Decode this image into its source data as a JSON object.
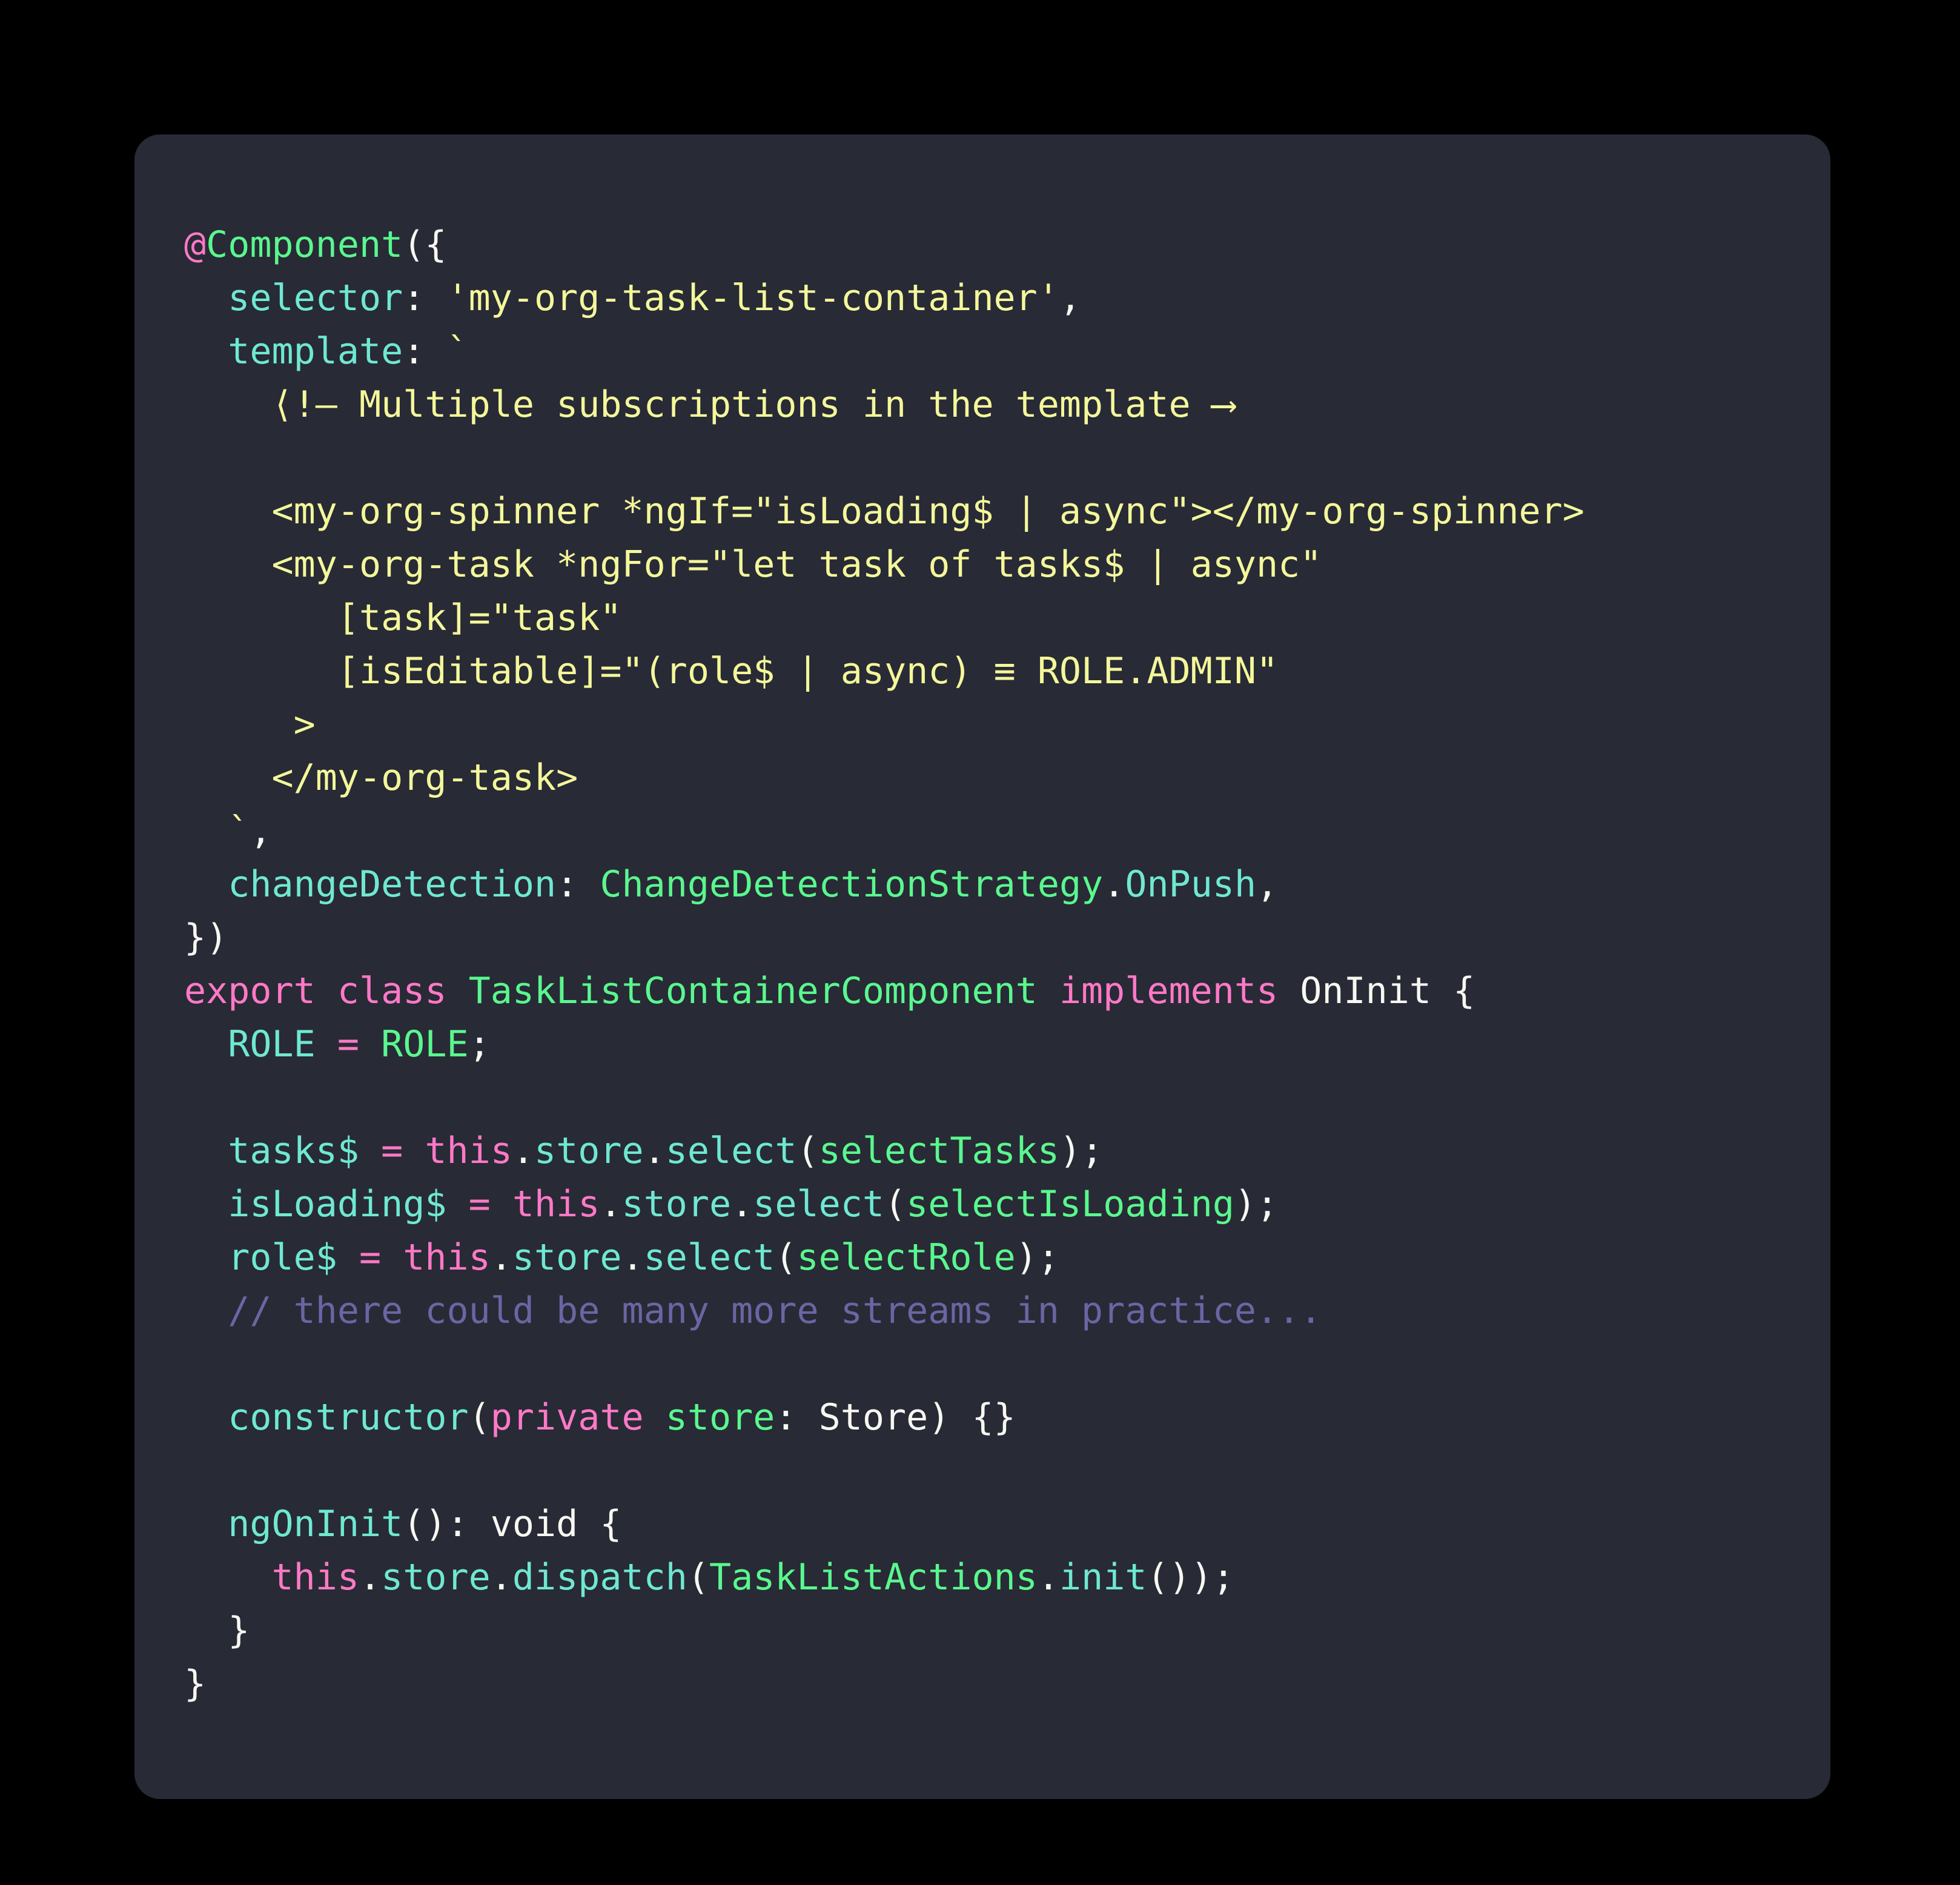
{
  "theme": {
    "page_background": "#000000",
    "card_background": "#282a36",
    "foreground": "#f8f8f2",
    "keyword_pink": "#ff79c6",
    "class_green": "#5af78e",
    "function_cyan": "#6fe8d2",
    "string_yellow": "#f4f79a",
    "comment_purple": "#6a66a3"
  },
  "code": {
    "language": "typescript",
    "title": "TaskListContainerComponent",
    "lines": [
      {
        "n": 1,
        "tokens": [
          {
            "t": "@",
            "c": "pink"
          },
          {
            "t": "Component",
            "c": "green"
          },
          {
            "t": "({",
            "c": "plain"
          }
        ]
      },
      {
        "n": 2,
        "tokens": [
          {
            "t": "  ",
            "c": "plain"
          },
          {
            "t": "selector",
            "c": "cyan"
          },
          {
            "t": ": ",
            "c": "plain"
          },
          {
            "t": "'my-org-task-list-container'",
            "c": "yellow"
          },
          {
            "t": ",",
            "c": "plain"
          }
        ]
      },
      {
        "n": 3,
        "tokens": [
          {
            "t": "  ",
            "c": "plain"
          },
          {
            "t": "template",
            "c": "cyan"
          },
          {
            "t": ": ",
            "c": "plain"
          },
          {
            "t": "`",
            "c": "yellow"
          }
        ]
      },
      {
        "n": 4,
        "tokens": [
          {
            "t": "    ",
            "c": "plain"
          },
          {
            "t": "<!-- Multiple subscriptions in the template -->",
            "c": "yellow"
          }
        ]
      },
      {
        "n": 5,
        "tokens": []
      },
      {
        "n": 6,
        "tokens": [
          {
            "t": "    ",
            "c": "plain"
          },
          {
            "t": "<my-org-spinner *ngIf=\"isLoading$ | async\"></my-org-spinner>",
            "c": "yellow"
          }
        ]
      },
      {
        "n": 7,
        "tokens": [
          {
            "t": "    ",
            "c": "plain"
          },
          {
            "t": "<my-org-task *ngFor=\"let task of tasks$ | async\"",
            "c": "yellow"
          }
        ]
      },
      {
        "n": 8,
        "tokens": [
          {
            "t": "       ",
            "c": "plain"
          },
          {
            "t": "[task]=\"task\"",
            "c": "yellow"
          }
        ]
      },
      {
        "n": 9,
        "tokens": [
          {
            "t": "       ",
            "c": "plain"
          },
          {
            "t": "[isEditable]=\"(role$ | async) === ROLE.ADMIN\"",
            "c": "yellow"
          }
        ]
      },
      {
        "n": 10,
        "tokens": [
          {
            "t": "     ",
            "c": "plain"
          },
          {
            "t": ">",
            "c": "yellow"
          }
        ]
      },
      {
        "n": 11,
        "tokens": [
          {
            "t": "    ",
            "c": "plain"
          },
          {
            "t": "</my-org-task>",
            "c": "yellow"
          }
        ]
      },
      {
        "n": 12,
        "tokens": [
          {
            "t": "  ",
            "c": "plain"
          },
          {
            "t": "`",
            "c": "yellow"
          },
          {
            "t": ",",
            "c": "plain"
          }
        ]
      },
      {
        "n": 13,
        "tokens": [
          {
            "t": "  ",
            "c": "plain"
          },
          {
            "t": "changeDetection",
            "c": "cyan"
          },
          {
            "t": ": ",
            "c": "plain"
          },
          {
            "t": "ChangeDetectionStrategy",
            "c": "green"
          },
          {
            "t": ".",
            "c": "plain"
          },
          {
            "t": "OnPush",
            "c": "cyan"
          },
          {
            "t": ",",
            "c": "plain"
          }
        ]
      },
      {
        "n": 14,
        "tokens": [
          {
            "t": "})",
            "c": "plain"
          }
        ]
      },
      {
        "n": 15,
        "tokens": [
          {
            "t": "export class ",
            "c": "pink"
          },
          {
            "t": "TaskListContainerComponent",
            "c": "green"
          },
          {
            "t": " ",
            "c": "plain"
          },
          {
            "t": "implements",
            "c": "pink"
          },
          {
            "t": " ",
            "c": "plain"
          },
          {
            "t": "OnInit",
            "c": "plain"
          },
          {
            "t": " {",
            "c": "plain"
          }
        ]
      },
      {
        "n": 16,
        "tokens": [
          {
            "t": "  ",
            "c": "plain"
          },
          {
            "t": "ROLE",
            "c": "cyan"
          },
          {
            "t": " ",
            "c": "plain"
          },
          {
            "t": "=",
            "c": "pink"
          },
          {
            "t": " ",
            "c": "plain"
          },
          {
            "t": "ROLE",
            "c": "green"
          },
          {
            "t": ";",
            "c": "plain"
          }
        ]
      },
      {
        "n": 17,
        "tokens": []
      },
      {
        "n": 18,
        "tokens": [
          {
            "t": "  ",
            "c": "plain"
          },
          {
            "t": "tasks$",
            "c": "cyan"
          },
          {
            "t": " ",
            "c": "plain"
          },
          {
            "t": "=",
            "c": "pink"
          },
          {
            "t": " ",
            "c": "plain"
          },
          {
            "t": "this",
            "c": "pink"
          },
          {
            "t": ".",
            "c": "plain"
          },
          {
            "t": "store",
            "c": "cyan"
          },
          {
            "t": ".",
            "c": "plain"
          },
          {
            "t": "select",
            "c": "cyan"
          },
          {
            "t": "(",
            "c": "plain"
          },
          {
            "t": "selectTasks",
            "c": "green"
          },
          {
            "t": ");",
            "c": "plain"
          }
        ]
      },
      {
        "n": 19,
        "tokens": [
          {
            "t": "  ",
            "c": "plain"
          },
          {
            "t": "isLoading$",
            "c": "cyan"
          },
          {
            "t": " ",
            "c": "plain"
          },
          {
            "t": "=",
            "c": "pink"
          },
          {
            "t": " ",
            "c": "plain"
          },
          {
            "t": "this",
            "c": "pink"
          },
          {
            "t": ".",
            "c": "plain"
          },
          {
            "t": "store",
            "c": "cyan"
          },
          {
            "t": ".",
            "c": "plain"
          },
          {
            "t": "select",
            "c": "cyan"
          },
          {
            "t": "(",
            "c": "plain"
          },
          {
            "t": "selectIsLoading",
            "c": "green"
          },
          {
            "t": ");",
            "c": "plain"
          }
        ]
      },
      {
        "n": 20,
        "tokens": [
          {
            "t": "  ",
            "c": "plain"
          },
          {
            "t": "role$",
            "c": "cyan"
          },
          {
            "t": " ",
            "c": "plain"
          },
          {
            "t": "=",
            "c": "pink"
          },
          {
            "t": " ",
            "c": "plain"
          },
          {
            "t": "this",
            "c": "pink"
          },
          {
            "t": ".",
            "c": "plain"
          },
          {
            "t": "store",
            "c": "cyan"
          },
          {
            "t": ".",
            "c": "plain"
          },
          {
            "t": "select",
            "c": "cyan"
          },
          {
            "t": "(",
            "c": "plain"
          },
          {
            "t": "selectRole",
            "c": "green"
          },
          {
            "t": ");",
            "c": "plain"
          }
        ]
      },
      {
        "n": 21,
        "tokens": [
          {
            "t": "  ",
            "c": "plain"
          },
          {
            "t": "// there could be many more streams in practice...",
            "c": "comment"
          }
        ]
      },
      {
        "n": 22,
        "tokens": []
      },
      {
        "n": 23,
        "tokens": [
          {
            "t": "  ",
            "c": "plain"
          },
          {
            "t": "constructor",
            "c": "cyan"
          },
          {
            "t": "(",
            "c": "plain"
          },
          {
            "t": "private",
            "c": "pink"
          },
          {
            "t": " ",
            "c": "plain"
          },
          {
            "t": "store",
            "c": "green"
          },
          {
            "t": ": ",
            "c": "plain"
          },
          {
            "t": "Store",
            "c": "plain"
          },
          {
            "t": ") {}",
            "c": "plain"
          }
        ]
      },
      {
        "n": 24,
        "tokens": []
      },
      {
        "n": 25,
        "tokens": [
          {
            "t": "  ",
            "c": "plain"
          },
          {
            "t": "ngOnInit",
            "c": "cyan"
          },
          {
            "t": "(): ",
            "c": "plain"
          },
          {
            "t": "void",
            "c": "plain"
          },
          {
            "t": " {",
            "c": "plain"
          }
        ]
      },
      {
        "n": 26,
        "tokens": [
          {
            "t": "    ",
            "c": "plain"
          },
          {
            "t": "this",
            "c": "pink"
          },
          {
            "t": ".",
            "c": "plain"
          },
          {
            "t": "store",
            "c": "cyan"
          },
          {
            "t": ".",
            "c": "plain"
          },
          {
            "t": "dispatch",
            "c": "cyan"
          },
          {
            "t": "(",
            "c": "plain"
          },
          {
            "t": "TaskListActions",
            "c": "green"
          },
          {
            "t": ".",
            "c": "plain"
          },
          {
            "t": "init",
            "c": "cyan"
          },
          {
            "t": "());",
            "c": "plain"
          }
        ]
      },
      {
        "n": 27,
        "tokens": [
          {
            "t": "  }",
            "c": "plain"
          }
        ]
      },
      {
        "n": 28,
        "tokens": [
          {
            "t": "}",
            "c": "plain"
          }
        ]
      }
    ]
  }
}
